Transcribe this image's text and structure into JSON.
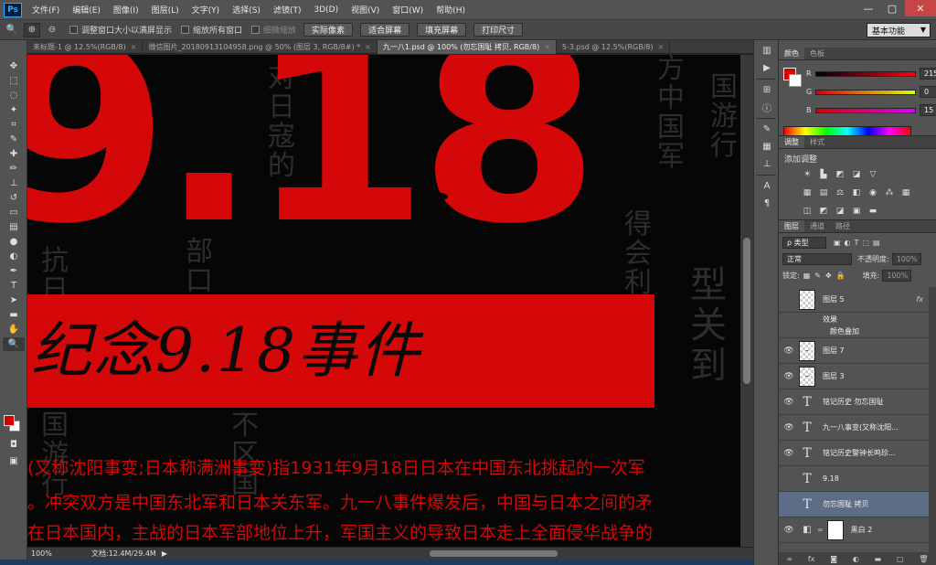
{
  "menu": {
    "logo": "Ps",
    "items": [
      "文件(F)",
      "编辑(E)",
      "图像(I)",
      "图层(L)",
      "文字(Y)",
      "选择(S)",
      "滤镜(T)",
      "3D(D)",
      "视图(V)",
      "窗口(W)",
      "帮助(H)"
    ]
  },
  "window_controls": {
    "minimize": "—",
    "maximize": "▢",
    "close": "✕"
  },
  "options": {
    "zoom_in_icon": "zoom-in-icon",
    "resize_windows_label": "调整窗口大小以满屏显示",
    "zoom_all_label": "缩放所有窗口",
    "scrubby_zoom_label": "细微缩放",
    "actual_pixels": "实际像素",
    "fit_screen": "适合屏幕",
    "fill_screen": "填充屏幕",
    "print_size": "打印尺寸",
    "workspace": "基本功能"
  },
  "tabs": [
    {
      "label": "未标题-1 @ 12.5%(RGB/8)",
      "active": false
    },
    {
      "label": "微信图片_20180913104958.png @ 50% (图层 3, RGB/8#) *",
      "active": false
    },
    {
      "label": "九一八1.psd @ 100% (勿忘国耻 拷贝, RGB/8)",
      "active": true
    },
    {
      "label": "5-3.psd @ 12.5%(RGB/8)",
      "active": false
    }
  ],
  "canvas": {
    "big_number": "9.18",
    "banner_text": "纪念9.18事件",
    "body_lines": [
      "(又称沈阳事变;日本称满洲事变)指1931年9月18日日本在中国东北挑起的一次军",
      "。冲突双方是中国东北军和日本关东军。九一八事件爆发后，中国与日本之间的矛",
      "在日本国内，主战的日本军部地位上升，军国主义的导致日本走上全面侵华战争的"
    ],
    "bg_columns": [
      "对日寇的",
      "抗日国旗",
      "部口中国",
      "不区国",
      "国游行",
      "方中国军",
      "国游行",
      "得会利",
      "型关到"
    ]
  },
  "status": {
    "zoom": "100%",
    "doc_info": "文档:12.4M/29.4M"
  },
  "color_panel": {
    "tabs": [
      "颜色",
      "色板"
    ],
    "r_label": "R",
    "g_label": "G",
    "b_label": "B",
    "r": "215",
    "g": "0",
    "b": "15",
    "fg_color": "#d7000f"
  },
  "adjust_panel": {
    "tabs": [
      "调整",
      "样式"
    ],
    "title": "添加调整"
  },
  "layers_panel": {
    "tabs": [
      "图层",
      "通道",
      "路径"
    ],
    "filter": "ρ 类型",
    "blend_mode": "正常",
    "opacity_label": "不透明度:",
    "opacity": "100%",
    "lock_label": "锁定:",
    "fill_label": "填充:",
    "fill": "100%",
    "layers": [
      {
        "name": "图层 5",
        "type": "image",
        "visible": false,
        "fx": true,
        "selected": false
      },
      {
        "name": "效果",
        "type": "sub",
        "visible": false
      },
      {
        "name": "颜色叠加",
        "type": "sub",
        "visible": false
      },
      {
        "name": "图层 7",
        "type": "image",
        "visible": true,
        "selected": false
      },
      {
        "name": "图层 3",
        "type": "image",
        "visible": true,
        "selected": false
      },
      {
        "name": "铭记历史  勿忘国耻",
        "type": "text",
        "visible": true,
        "selected": false
      },
      {
        "name": "九一八事变(又称沈阳...",
        "type": "text",
        "visible": true,
        "selected": false
      },
      {
        "name": "铭记历史警钟长鸣珍...",
        "type": "text",
        "visible": true,
        "selected": false
      },
      {
        "name": "9.18",
        "type": "text",
        "visible": false,
        "selected": false
      },
      {
        "name": "勿忘国耻 拷贝",
        "type": "text",
        "visible": false,
        "selected": true
      },
      {
        "name": "黑白 2",
        "type": "adjust",
        "visible": true,
        "selected": false
      }
    ],
    "footer_icons": [
      "link-icon",
      "fx-icon",
      "mask-icon",
      "adjust-icon",
      "folder-icon",
      "new-layer-icon",
      "trash-icon"
    ]
  }
}
